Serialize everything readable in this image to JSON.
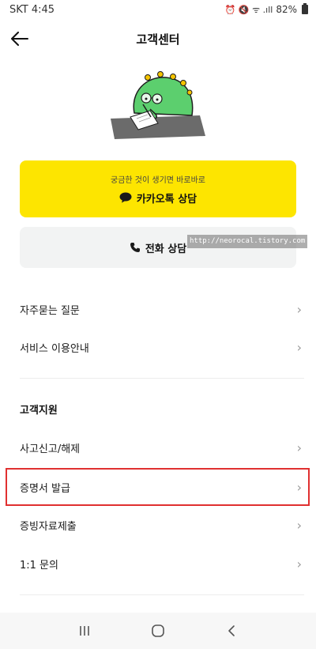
{
  "status_bar": {
    "carrier_time": "SKT 4:45",
    "indicators": "⏰ 🔇 ᯤ .ıll",
    "battery": "82%"
  },
  "header": {
    "title": "고객센터",
    "back_icon": "arrow-left-icon"
  },
  "kakao": {
    "subtitle": "궁금한 것이 생기면 바로바로",
    "label": "카카오톡 상담",
    "icon": "speech-bubble-icon",
    "color": "#fde500"
  },
  "phone": {
    "label": "전화 상담",
    "icon": "phone-icon"
  },
  "watermark": "http://neorocal.tistory.com",
  "faq": {
    "items": [
      {
        "label": "자주묻는 질문"
      },
      {
        "label": "서비스 이용안내"
      }
    ]
  },
  "support": {
    "title": "고객지원",
    "items": [
      {
        "label": "사고신고/해제"
      },
      {
        "label": "증명서 발급"
      },
      {
        "label": "증빙자료제출"
      },
      {
        "label": "1:1 문의"
      }
    ],
    "highlight_color": "#e03030"
  },
  "nav": {
    "recents": "recents-icon",
    "home": "home-icon",
    "back": "back-icon"
  }
}
